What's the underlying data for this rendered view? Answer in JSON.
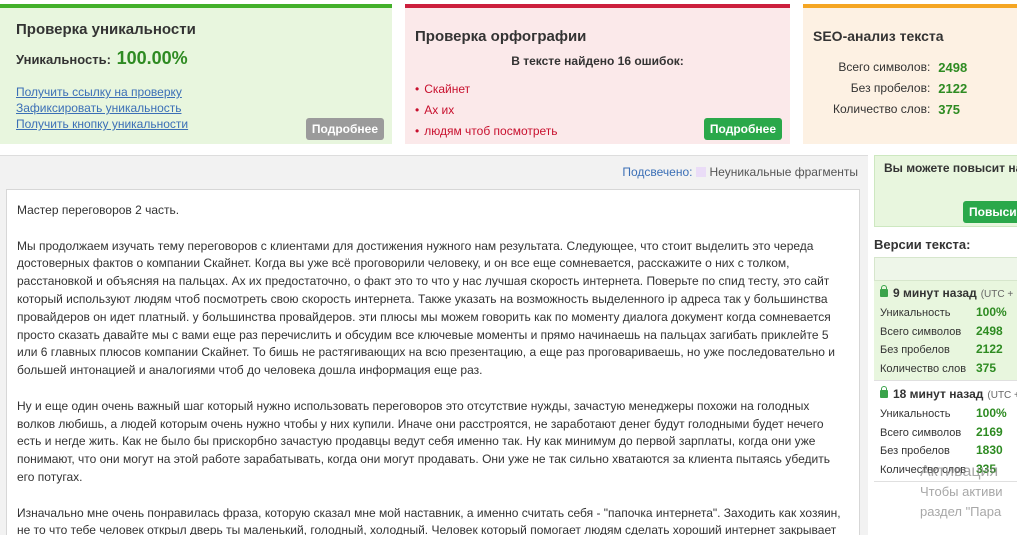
{
  "uniqueness_panel": {
    "title": "Проверка уникальности",
    "label": "Уникальность:",
    "value": "100.00%",
    "links": [
      "Получить ссылку на проверку",
      "Зафиксировать уникальность",
      "Получить кнопку уникальности"
    ],
    "details_button": "Подробнее"
  },
  "spelling_panel": {
    "title": "Проверка орфографии",
    "found_text": "В тексте найдено 16 ошибок:",
    "errors": [
      "Скайнет",
      "Ах их",
      "людям чтоб посмотреть"
    ],
    "details_button": "Подробнее"
  },
  "seo_panel": {
    "title": "SEO-анализ текста",
    "rows": [
      {
        "label": "Всего символов:",
        "value": "2498"
      },
      {
        "label": "Без пробелов:",
        "value": "2122"
      },
      {
        "label": "Количество слов:",
        "value": "375"
      }
    ]
  },
  "highlight_legend": {
    "label": "Подсвечено:",
    "item": "Неуникальные фрагменты"
  },
  "text": {
    "paragraphs": [
      "Мастер переговоров 2 часть.",
      "Мы продолжаем изучать тему переговоров с клиентами для достижения нужного нам результата. Следующее, что стоит выделить это череда достоверных фактов о компании Скайнет. Когда вы уже всё проговорили человеку, и он все еще сомневается, расскажите о них с толком, расстановкой и объясняя на пальцах. Ах их предостаточно, о факт это то что у нас лучшая скорость интернета. Поверьте по спид тесту, это сайт который используют людям чтоб посмотреть свою скорость интернета. Также указать на возможность выделенного ip адреса так у большинства провайдеров он идет платный. у большинства провайдеров. эти плюсы мы можем говорить как по моменту диалога документ когда сомневается просто сказать давайте мы с вами еще раз перечислить и обсудим все ключевые моменты и прямо начинаешь на пальцах загибать приклейте 5 или 6 главных плюсов компании Скайнет. То бишь не растягивающих на всю презентацию, а еще раз проговариваешь,  но уже последовательно и большей интонацией и аналогиями чтоб до человека дошла информация еще раз.",
      "Ну и еще один очень важный шаг который нужно использовать переговоров это отсутствие нужды, зачастую менеджеры похожи на голодных волков любишь, а людей которым очень нужно чтобы у них купили. Иначе они расстроятся, не заработают денег будут голодными будет нечего есть и негде жить. Как не было бы прискорбно зачастую продавцы ведут себя именно так. Ну как минимум до первой зарплаты, когда они уже понимают, что они могут на этой работе зарабатывать, когда они могут продавать. Они уже не так сильно хватаются за клиента пытаясь убедить его потугах.",
      "Изначально мне очень понравилась фраза, которую сказал мне мой наставник, а именно считать себя - \"папочка интернета\". Заходить как хозяин, не то что тебе человек открыл дверь ты маленький, голодный, холодный. Человек который помогает людям сделать хороший интернет закрывает"
    ]
  },
  "sidebar": {
    "promo_text": "Вы можете повысит нашей Бир",
    "promo_button": "Повысит",
    "versions_title": "Версии текста:",
    "versions": [
      {
        "time": "9 минут назад",
        "utc": "(UTC +",
        "rows": [
          {
            "label": "Уникальность",
            "value": "100%"
          },
          {
            "label": "Всего символов",
            "value": "2498"
          },
          {
            "label": "Без пробелов",
            "value": "2122"
          },
          {
            "label": "Количество слов",
            "value": "375"
          }
        ]
      },
      {
        "time": "18 минут назад",
        "utc": "(UTC +",
        "rows": [
          {
            "label": "Уникальность",
            "value": "100%"
          },
          {
            "label": "Всего символов",
            "value": "2169"
          },
          {
            "label": "Без пробелов",
            "value": "1830"
          },
          {
            "label": "Количество слов",
            "value": "335"
          }
        ]
      }
    ]
  },
  "activation_watermark": {
    "title": "Активация",
    "line1": "Чтобы активи",
    "line2": "раздел \"Пара"
  }
}
